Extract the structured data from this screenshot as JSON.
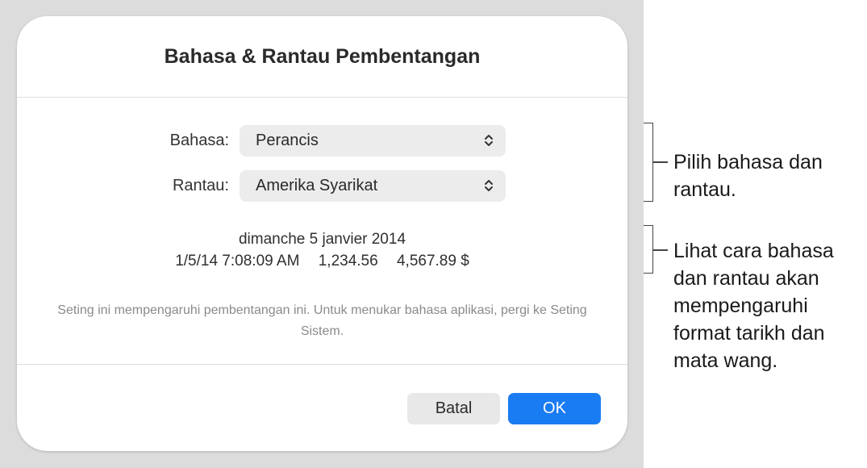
{
  "dialog": {
    "title": "Bahasa & Rantau Pembentangan",
    "language": {
      "label": "Bahasa:",
      "value": "Perancis"
    },
    "region": {
      "label": "Rantau:",
      "value": "Amerika Syarikat"
    },
    "preview": {
      "date_long": "dimanche 5 janvier 2014",
      "datetime": "1/5/14 7:08:09 AM",
      "number": "1,234.56",
      "currency": "4,567.89 $"
    },
    "note": "Seting ini mempengaruhi pembentangan ini. Untuk menukar bahasa aplikasi, pergi ke Seting Sistem.",
    "buttons": {
      "cancel": "Batal",
      "ok": "OK"
    }
  },
  "callouts": {
    "first": "Pilih bahasa dan rantau.",
    "second": "Lihat cara bahasa dan rantau akan mempengaruhi format tarikh dan mata wang."
  },
  "colors": {
    "accent": "#1a7cf2",
    "backdrop": "#dcdcdc"
  }
}
